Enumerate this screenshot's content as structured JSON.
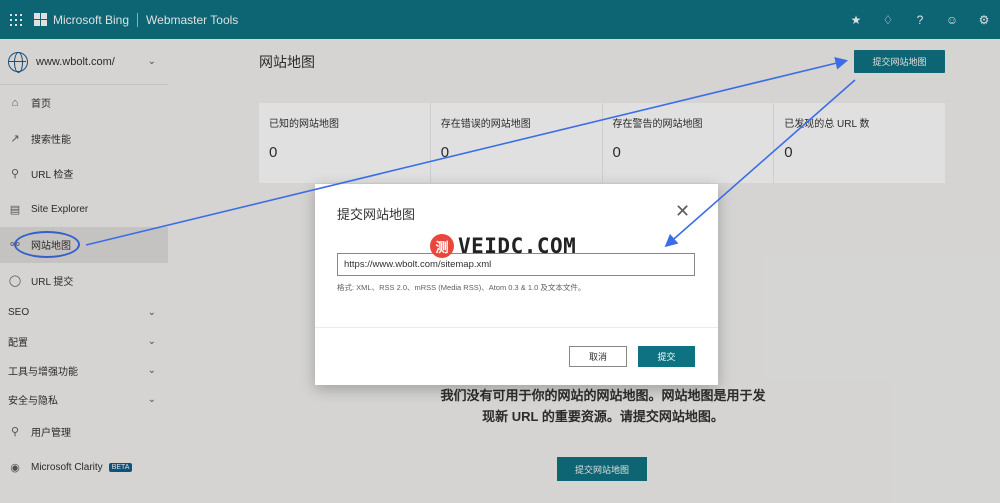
{
  "topbar": {
    "brand": "Microsoft Bing",
    "product": "Webmaster Tools",
    "icons": [
      "trophy-icon",
      "bell-icon",
      "help-icon",
      "smiley-icon",
      "gear-icon"
    ]
  },
  "sidebar": {
    "site": "www.wbolt.com/",
    "items": [
      {
        "label": "首页",
        "icon": "home-icon"
      },
      {
        "label": "搜索性能",
        "icon": "trend-icon"
      },
      {
        "label": "URL 检查",
        "icon": "search-icon"
      },
      {
        "label": "Site Explorer",
        "icon": "document-icon"
      },
      {
        "label": "网站地图",
        "icon": "sitemap-icon"
      },
      {
        "label": "URL 提交",
        "icon": "globe-icon"
      }
    ],
    "sections": [
      "SEO",
      "配置",
      "工具与增强功能",
      "安全与隐私"
    ],
    "footer_items": [
      {
        "label": "用户管理",
        "icon": "user-icon"
      },
      {
        "label": "Microsoft Clarity",
        "icon": "clarity-icon",
        "badge": "BETA"
      }
    ]
  },
  "main": {
    "title": "网站地图",
    "submit_label": "提交网站地图",
    "stats": [
      {
        "label": "已知的网站地图",
        "value": "0"
      },
      {
        "label": "存在错误的网站地图",
        "value": "0"
      },
      {
        "label": "存在警告的网站地图",
        "value": "0"
      },
      {
        "label": "已发现的总 URL 数",
        "value": "0"
      }
    ],
    "empty_line1": "我们没有可用于你的网站的网站地图。网站地图是用于发",
    "empty_line2": "现新 URL 的重要资源。请提交网站地图。",
    "bottom_submit_label": "提交网站地图"
  },
  "dialog": {
    "title": "提交网站地图",
    "input_value": "https://www.wbolt.com/sitemap.xml",
    "hint": "格式: XML、RSS 2.0、mRSS (Media RSS)、Atom 0.3 & 1.0 及文本文件。",
    "cancel_label": "取消",
    "submit_label": "提交"
  },
  "watermark": {
    "badge": "测",
    "text": "VEIDC.COM"
  },
  "colors": {
    "topbar": "#0f7283",
    "accent": "#0f7283",
    "annotation": "#3b6ee6"
  }
}
